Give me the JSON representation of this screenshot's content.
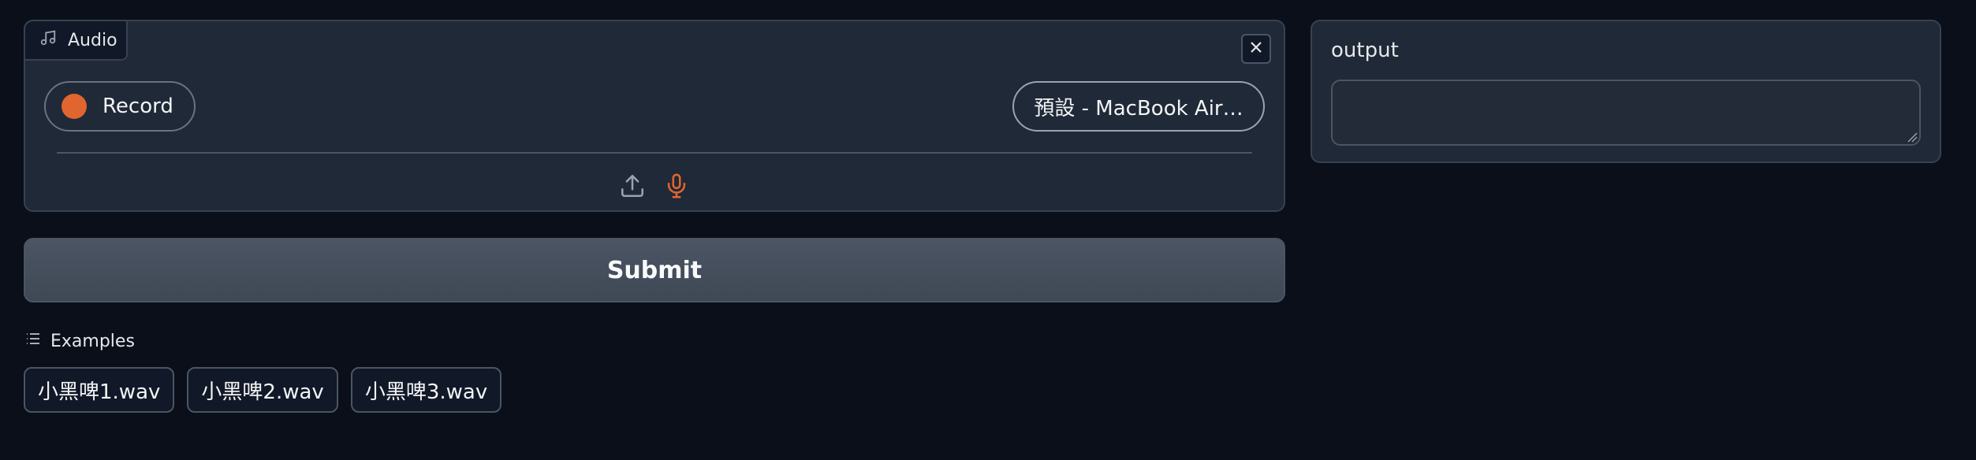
{
  "audio": {
    "label": "Audio",
    "record_label": "Record",
    "device_label": "預設 - MacBook Air…"
  },
  "submit_label": "Submit",
  "examples": {
    "title": "Examples",
    "items": [
      "小黑啤1.wav",
      "小黑啤2.wav",
      "小黑啤3.wav"
    ]
  },
  "output": {
    "label": "output",
    "value": ""
  },
  "icons": {
    "audio": "music-note-icon",
    "close": "close-icon",
    "upload": "upload-icon",
    "microphone": "microphone-icon",
    "examples": "list-icon"
  },
  "colors": {
    "background": "#0b0f19",
    "panel": "#1f2937",
    "accent": "#e0652e"
  }
}
